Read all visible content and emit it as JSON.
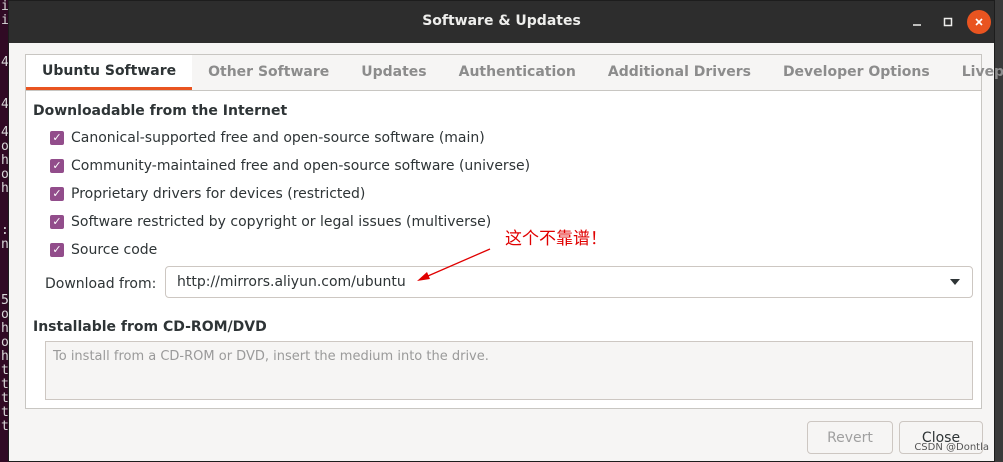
{
  "background_terminal": {
    "lines": [
      "i",
      "i",
      "",
      "",
      "4",
      "",
      "",
      "4",
      "",
      "4",
      "o",
      "h",
      "o",
      "h",
      "",
      "",
      ":",
      "n",
      "",
      "",
      "",
      "5",
      "o",
      "h",
      "o",
      "h",
      "t",
      "t",
      "t",
      "t",
      "t"
    ]
  },
  "window": {
    "title": "Software & Updates",
    "controls": {
      "minimize": "_",
      "maximize": "□",
      "close": "✕"
    }
  },
  "tabs": [
    {
      "label": "Ubuntu Software",
      "active": true
    },
    {
      "label": "Other Software",
      "active": false
    },
    {
      "label": "Updates",
      "active": false
    },
    {
      "label": "Authentication",
      "active": false
    },
    {
      "label": "Additional Drivers",
      "active": false
    },
    {
      "label": "Developer Options",
      "active": false
    },
    {
      "label": "Livepatch",
      "active": false
    }
  ],
  "downloadable": {
    "heading": "Downloadable from the Internet",
    "options": [
      {
        "label": "Canonical-supported free and open-source software (main)",
        "checked": true
      },
      {
        "label": "Community-maintained free and open-source software (universe)",
        "checked": true
      },
      {
        "label": "Proprietary drivers for devices (restricted)",
        "checked": true
      },
      {
        "label": "Software restricted by copyright or legal issues (multiverse)",
        "checked": true
      },
      {
        "label": "Source code",
        "checked": true
      }
    ],
    "download_from_label": "Download from:",
    "download_from_value": "http://mirrors.aliyun.com/ubuntu"
  },
  "cdrom": {
    "heading": "Installable from CD-ROM/DVD",
    "placeholder": "To install from a CD-ROM or DVD, insert the medium into the drive."
  },
  "annotation": {
    "text": "这个不靠谱！",
    "color": "#e00000"
  },
  "buttons": {
    "revert": "Revert",
    "close": "Close"
  },
  "watermark": "CSDN @Dontla",
  "colors": {
    "accent": "#e95420",
    "checkbox": "#924d8b",
    "titlebar": "#2d2d2d"
  }
}
